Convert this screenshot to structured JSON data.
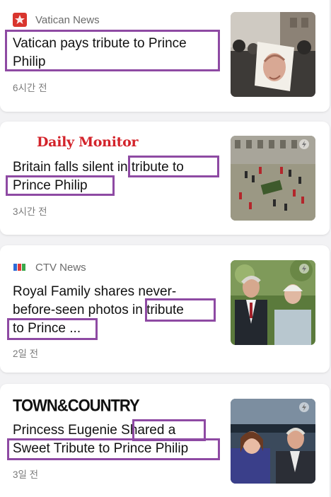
{
  "articles": [
    {
      "source": "Vatican News",
      "source_icon": "vatican-news-icon",
      "headline_lines": [
        "Vatican pays tribute to Prince",
        "Philip"
      ],
      "time": "6시간 전",
      "thumb": "crowd-with-portrait-photo"
    },
    {
      "source": "Daily Monitor",
      "source_icon": "daily-monitor-logo",
      "headline_lines": [
        "Britain falls silent in tribute to",
        "Prince Philip"
      ],
      "time": "3시간 전",
      "thumb": "funeral-procession-photo"
    },
    {
      "source": "CTV News",
      "source_icon": "ctv-news-icon",
      "headline_lines": [
        "Royal Family shares never-",
        "before-seen photos in tribute",
        "to Prince ..."
      ],
      "time": "2일 전",
      "thumb": "royal-couple-photo"
    },
    {
      "source": "TOWN&COUNTRY",
      "source_icon": "town-and-country-logo",
      "headline_lines": [
        "Princess Eugenie Shared a",
        "Sweet Tribute to Prince Philip"
      ],
      "time": "3일 전",
      "thumb": "eugenie-and-philip-photo"
    }
  ],
  "colors": {
    "highlight": "#8e4aa3",
    "daily_monitor_red": "#d3232a",
    "vatican_red": "#d9352e",
    "ctv_blue": "#2d6bd6"
  }
}
